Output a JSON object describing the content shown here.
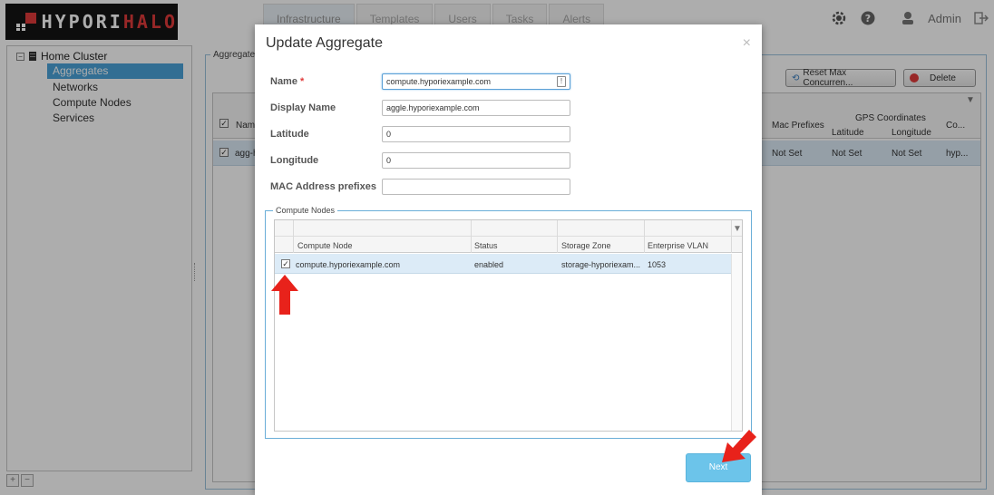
{
  "header": {
    "logo_white": "HYPORI",
    "logo_red": "HALO",
    "tabs": [
      "Infrastructure",
      "Templates",
      "Users",
      "Tasks",
      "Alerts"
    ],
    "admin_label": "Admin"
  },
  "sidebar": {
    "root_label": "Home Cluster",
    "items": [
      "Aggregates",
      "Networks",
      "Compute Nodes",
      "Services"
    ],
    "selected": "Aggregates"
  },
  "main": {
    "legend": "Aggregates",
    "reset_button": "Reset Max Concurren...",
    "delete_button": "Delete",
    "columns": {
      "name_trunc": "Nam",
      "mac_prefixes": "Mac Prefixes",
      "gps": "GPS Coordinates",
      "latitude": "Latitude",
      "longitude": "Longitude",
      "co": "Co..."
    },
    "row": {
      "name": "agg-h",
      "mac": "Not Set",
      "lat": "Not Set",
      "lon": "Not Set",
      "co": "hyp..."
    }
  },
  "modal": {
    "title": "Update Aggregate",
    "close": "×",
    "fields": {
      "name_label": "Name",
      "name_required": "*",
      "name_value": "compute.hyporiexample.com",
      "display_label": "Display Name",
      "display_value": "aggle.hyporiexample.com",
      "lat_label": "Latitude",
      "lat_value": "0",
      "lon_label": "Longitude",
      "lon_value": "0",
      "mac_label": "MAC Address prefixes",
      "mac_value": ""
    },
    "compute_nodes": {
      "legend": "Compute Nodes",
      "headers": [
        "Compute Node",
        "Status",
        "Storage Zone",
        "Enterprise VLAN"
      ],
      "rows": [
        {
          "checked": true,
          "node": "compute.hyporiexample.com",
          "status": "enabled",
          "zone": "storage-hyporiexam...",
          "vlan": "1053"
        }
      ]
    },
    "next_button": "Next"
  },
  "colors": {
    "accent_blue": "#4ba3d9",
    "next_button": "#6cc4ea",
    "arrow_red": "#e8221b",
    "logo_red": "#e03a3a"
  }
}
